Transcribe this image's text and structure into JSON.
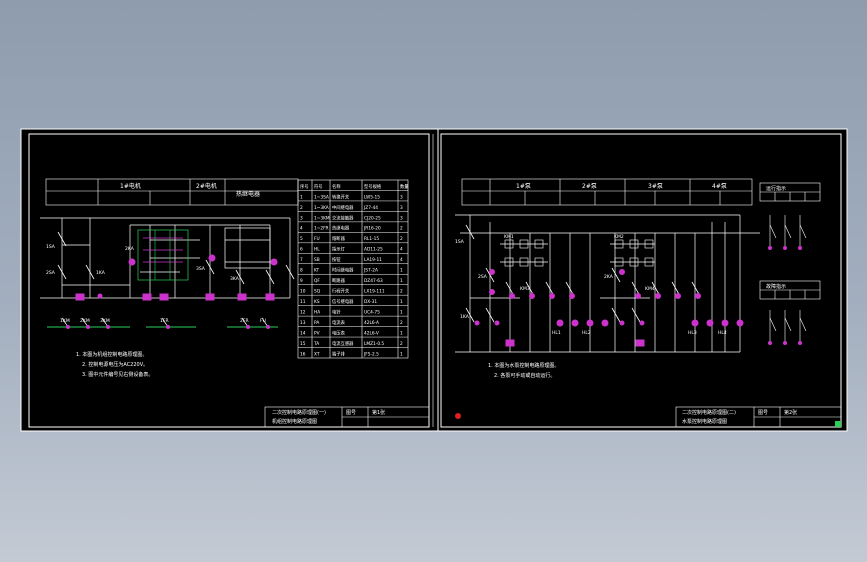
{
  "colors": {
    "background_top": "#8e9cae",
    "background_bottom": "#c3cad4",
    "sheet": "#000000",
    "line": "#ffffff",
    "component": "#cc33cc",
    "bus": "#2bd05b"
  },
  "left_sheet": {
    "table_header": {
      "col1": "1#电机",
      "col2": "2#电机",
      "col3": "热继电器"
    },
    "labels": [
      "1SA",
      "2SA",
      "1KA",
      "2KA",
      "3SA",
      "3KA",
      "1KM",
      "2KM",
      "3KM",
      "1FR",
      "2FR",
      "FU"
    ],
    "notes": [
      "1. 本图为机组控制电路原理图。",
      "2. 控制电源电压为AC220V。",
      "3. 图中元件编号见右侧设备表。"
    ],
    "equipment_table": {
      "headers": [
        "序号",
        "符号",
        "名称",
        "型号规格",
        "数量"
      ],
      "rows": [
        [
          "1",
          "1~3SA",
          "转换开关",
          "LW5-15",
          "3"
        ],
        [
          "2",
          "1~3KA",
          "中间继电器",
          "JZ7-44",
          "3"
        ],
        [
          "3",
          "1~3KM",
          "交流接触器",
          "CJ20-25",
          "3"
        ],
        [
          "4",
          "1~2FR",
          "热继电器",
          "JR16-20",
          "2"
        ],
        [
          "5",
          "FU",
          "熔断器",
          "RL1-15",
          "2"
        ],
        [
          "6",
          "HL",
          "指示灯",
          "AD11-25",
          "4"
        ],
        [
          "7",
          "SB",
          "按钮",
          "LA19-11",
          "4"
        ],
        [
          "8",
          "KT",
          "时间继电器",
          "JS7-2A",
          "1"
        ],
        [
          "9",
          "QF",
          "断路器",
          "DZ47-63",
          "1"
        ],
        [
          "10",
          "SQ",
          "行程开关",
          "LX19-111",
          "2"
        ],
        [
          "11",
          "KS",
          "信号继电器",
          "DX-31",
          "1"
        ],
        [
          "12",
          "HA",
          "电铃",
          "UC4-75",
          "1"
        ],
        [
          "13",
          "PA",
          "电流表",
          "42L6-A",
          "2"
        ],
        [
          "14",
          "PV",
          "电压表",
          "42L6-V",
          "1"
        ],
        [
          "15",
          "TA",
          "电流互感器",
          "LMZ1-0.5",
          "2"
        ],
        [
          "16",
          "XT",
          "端子排",
          "JF5-2.5",
          "1"
        ]
      ]
    },
    "title_block": {
      "title_line1": "二次控制电路原理图(一)",
      "title_line2": "机组控制电路原理图",
      "drawing_no_label": "图号",
      "sheet_label": "第1张"
    }
  },
  "right_sheet": {
    "table_header": {
      "col1": "1#泵",
      "col2": "2#泵",
      "col3": "3#泵",
      "col4": "4#泵"
    },
    "legend_top": "运行指示",
    "legend_bottom": "故障指示",
    "labels": [
      "1SA",
      "2SA",
      "1KA",
      "2KA",
      "KM1",
      "KM2",
      "KM3",
      "KM4",
      "HL1",
      "HL2",
      "HL3",
      "HL4"
    ],
    "notes": [
      "1. 本图为水泵控制电路原理图。",
      "2. 各泵可手动或自动运行。"
    ],
    "title_block": {
      "title_line1": "二次控制电路原理图(二)",
      "title_line2": "水泵控制电路原理图",
      "drawing_no_label": "图号",
      "sheet_label": "第2张"
    }
  }
}
